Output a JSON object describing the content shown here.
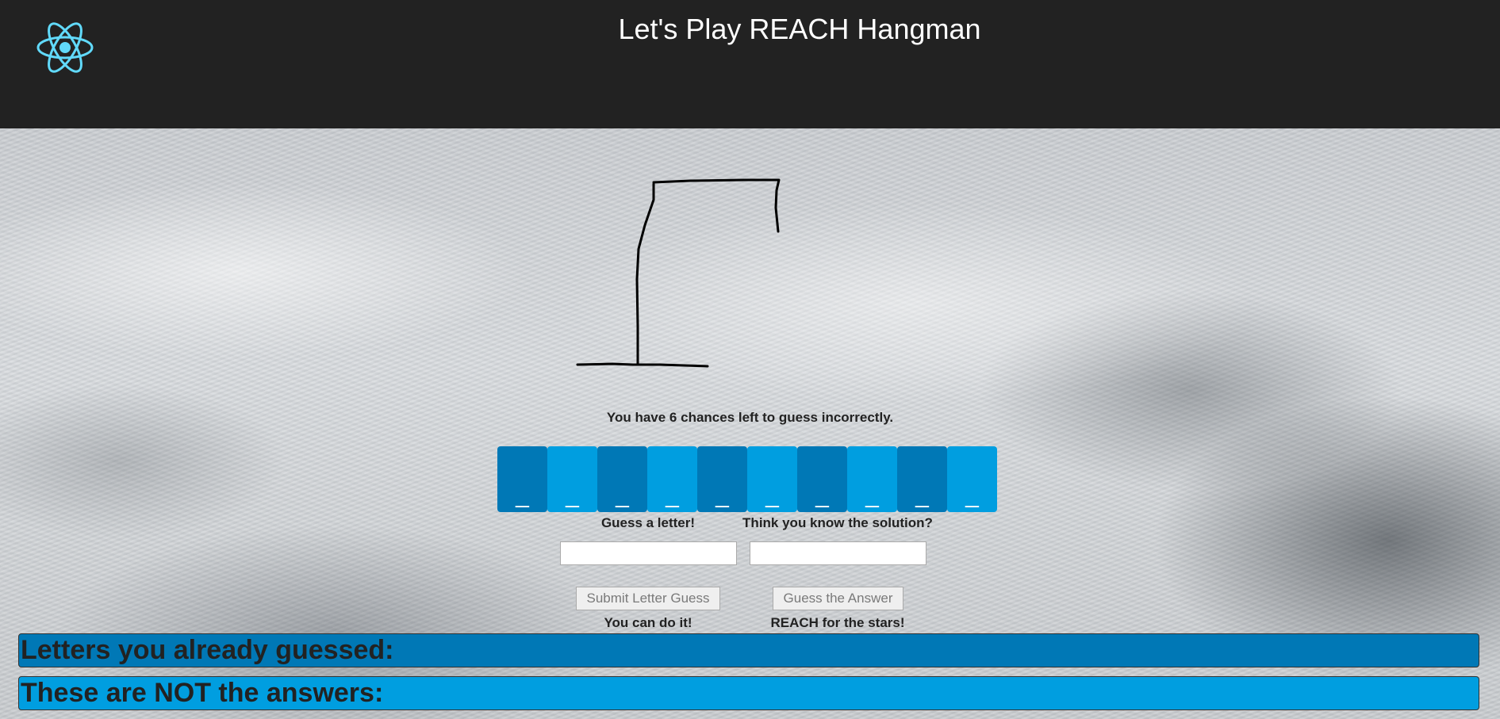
{
  "header": {
    "title": "Let's Play REACH Hangman",
    "logo_icon": "react-atom-icon",
    "background": "#222222",
    "logo_color": "#61dafb"
  },
  "game": {
    "chances_text": "You have 6 chances left to guess incorrectly.",
    "tiles": [
      "_",
      "_",
      "_",
      "_",
      "_",
      "_",
      "_",
      "_",
      "_",
      "_"
    ],
    "tile_colors": [
      "#0078b6",
      "#009ee0"
    ]
  },
  "letter_guess": {
    "label": "Guess a letter!",
    "value": "",
    "button_label": "Submit Letter Guess",
    "encouragement": "You can do it!"
  },
  "answer_guess": {
    "label": "Think you know the solution?",
    "value": "",
    "button_label": "Guess the Answer",
    "encouragement": "REACH for the stars!"
  },
  "panels": {
    "guessed_letters_label": "Letters you already guessed:",
    "not_answers_label": "These are NOT the answers:"
  }
}
